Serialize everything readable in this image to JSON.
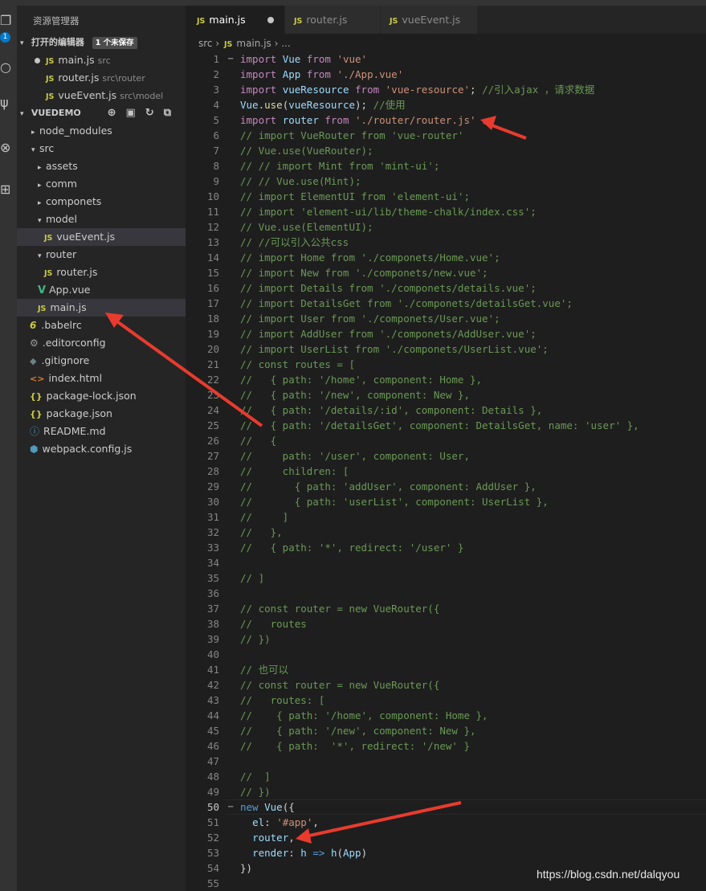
{
  "sidebar": {
    "title": "资源管理器",
    "open_editors_label": "打开的编辑器",
    "unsaved_badge": "1 个未保存",
    "open_editors": [
      {
        "name": "main.js",
        "dir": "src"
      },
      {
        "name": "router.js",
        "dir": "src\\router"
      },
      {
        "name": "vueEvent.js",
        "dir": "src\\model"
      }
    ],
    "project_label": "VUEDEMO",
    "tree": [
      "node_modules",
      "src",
      "assets",
      "comm",
      "componets",
      "model",
      "vueEvent.js",
      "router",
      "router.js",
      "App.vue",
      "main.js",
      ".babelrc",
      ".editorconfig",
      ".gitignore",
      "index.html",
      "package-lock.json",
      "package.json",
      "README.md",
      "webpack.config.js"
    ]
  },
  "activity": {
    "badge": "1"
  },
  "tabs": [
    {
      "label": "main.js",
      "active": true,
      "dirty": true
    },
    {
      "label": "router.js",
      "active": false
    },
    {
      "label": "vueEvent.js",
      "active": false
    }
  ],
  "breadcrumb": {
    "folder": "src",
    "sep": "›",
    "file": "main.js",
    "tail": "›  ..."
  },
  "editor": {
    "line_numbers": [
      "1",
      "2",
      "3",
      "4",
      "5",
      "6",
      "7",
      "8",
      "9",
      "10",
      "11",
      "12",
      "13",
      "14",
      "15",
      "16",
      "17",
      "18",
      "19",
      "20",
      "21",
      "22",
      "23",
      "24",
      "25",
      "26",
      "27",
      "28",
      "29",
      "30",
      "31",
      "32",
      "33",
      "34",
      "35",
      "36",
      "37",
      "38",
      "39",
      "40",
      "41",
      "42",
      "43",
      "44",
      "45",
      "46",
      "47",
      "48",
      "49",
      "50",
      "51",
      "52",
      "53",
      "54",
      "55"
    ],
    "current_line": "50",
    "lines": [
      "import Vue from 'vue'",
      "import App from './App.vue'",
      "import vueResource from 'vue-resource'; //引入ajax ，请求数据",
      "Vue.use(vueResource); //使用",
      "import router from './router/router.js'",
      "// import VueRouter from 'vue-router'",
      "// Vue.use(VueRouter);",
      "// // import Mint from 'mint-ui';",
      "// // Vue.use(Mint);",
      "// import ElementUI from 'element-ui';",
      "// import 'element-ui/lib/theme-chalk/index.css';",
      "// Vue.use(ElementUI);",
      "// //可以引入公共css",
      "// import Home from './componets/Home.vue';",
      "// import New from './componets/new.vue';",
      "// import Details from './componets/details.vue';",
      "// import DetailsGet from './componets/detailsGet.vue';",
      "// import User from './componets/User.vue';",
      "// import AddUser from './componets/AddUser.vue';",
      "// import UserList from './componets/UserList.vue';",
      "// const routes = [",
      "//   { path: '/home', component: Home },",
      "//   { path: '/new', component: New },",
      "//   { path: '/details/:id', component: Details },",
      "//   { path: '/detailsGet', component: DetailsGet, name: 'user' },",
      "//   {",
      "//     path: '/user', component: User,",
      "//     children: [",
      "//       { path: 'addUser', component: AddUser },",
      "//       { path: 'userList', component: UserList },",
      "//     ]",
      "//   },",
      "//   { path: '*', redirect: '/user' }",
      "",
      "// ]",
      "",
      "// const router = new VueRouter({",
      "//   routes",
      "// })",
      "",
      "// 也可以",
      "// const router = new VueRouter({",
      "//   routes: [",
      "//    { path: '/home', component: Home },",
      "//    { path: '/new', component: New },",
      "//    { path:  '*', redirect: '/new' }",
      "",
      "//  ]",
      "// })",
      "new Vue({",
      "  el: '#app',",
      "  router,",
      "  render: h => h(App)",
      "})",
      ""
    ]
  },
  "watermark": "https://blog.csdn.net/dalqyou",
  "colors": {
    "arrow": "#e83b2e",
    "keyword": "#569cd6",
    "comment": "#6a9955",
    "string": "#ce9178"
  }
}
